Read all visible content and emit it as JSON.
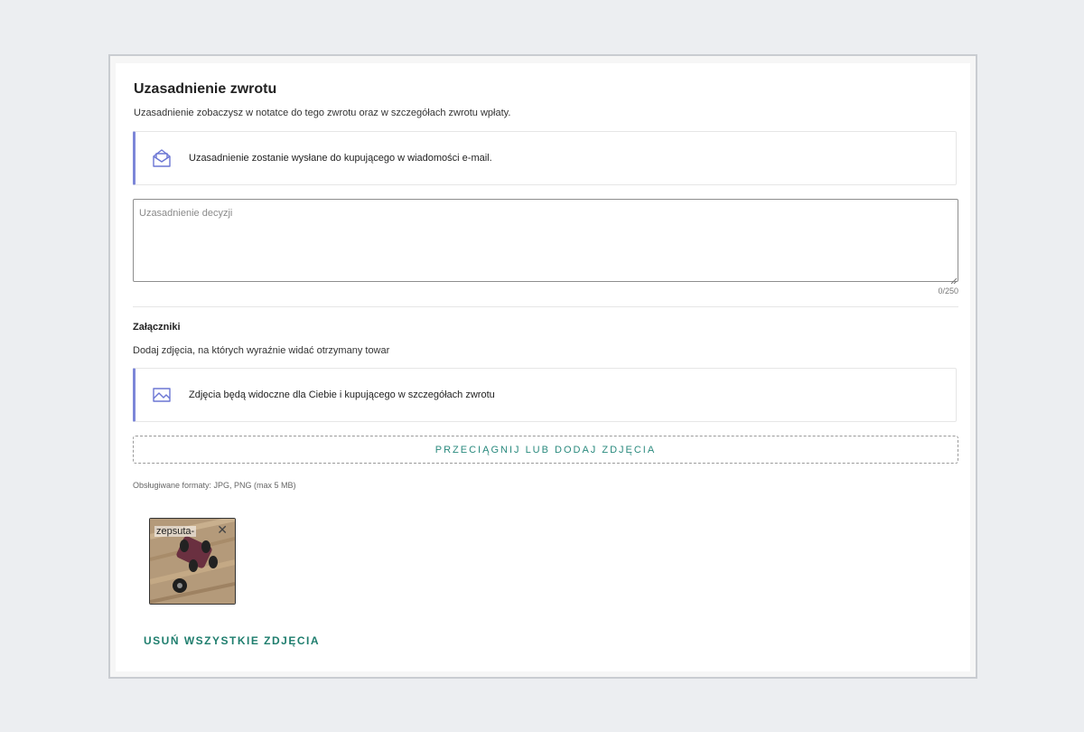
{
  "section": {
    "title": "Uzasadnienie zwrotu",
    "subtitle": "Uzasadnienie zobaczysz w notatce do tego zwrotu oraz w szczegółach zwrotu wpłaty."
  },
  "email_notice": {
    "icon": "envelope-icon",
    "text": "Uzasadnienie zostanie wysłane do kupującego w wiadomości e-mail."
  },
  "reason_field": {
    "placeholder": "Uzasadnienie decyzji",
    "value": "",
    "counter": "0/250"
  },
  "attachments": {
    "title": "Załączniki",
    "subtitle": "Dodaj zdjęcia, na których wyraźnie widać otrzymany towar",
    "notice": {
      "icon": "image-icon",
      "text": "Zdjęcia będą widoczne dla Ciebie i kupującego w szczegółach zwrotu"
    },
    "dropzone_label": "PRZECIĄGNIJ LUB DODAJ ZDJĘCIA",
    "formats": "Obsługiwane formaty: JPG, PNG (max 5 MB)",
    "photos": [
      {
        "name": "zepsuta-"
      }
    ],
    "remove_all_label": "USUŃ WSZYSTKIE ZDJĘCIA"
  },
  "colors": {
    "accent_green": "#1f7e6e",
    "notice_border": "#7c86d8",
    "icon_blue": "#6b76d4",
    "background": "#eceef1"
  }
}
